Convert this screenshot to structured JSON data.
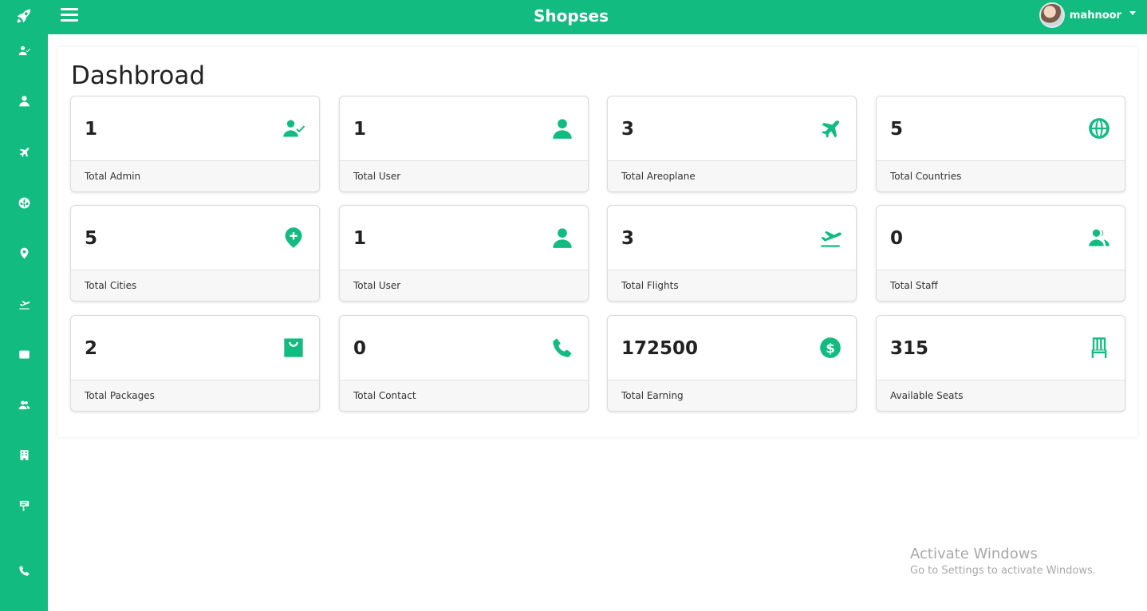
{
  "app": {
    "brand": "Shopses",
    "user_name": "mahnoor"
  },
  "colors": {
    "accent": "#12bb80",
    "text": "#222222",
    "footer": "#f7f7f7"
  },
  "page": {
    "title": "Dashbroad"
  },
  "sidebar": {
    "items": [
      {
        "icon": "rocket-icon"
      },
      {
        "icon": "user-check-icon"
      },
      {
        "icon": "user-icon"
      },
      {
        "icon": "plane-icon"
      },
      {
        "icon": "globe-icon"
      },
      {
        "icon": "map-pin-icon"
      },
      {
        "icon": "plane-departure-icon"
      },
      {
        "icon": "envelope-icon"
      },
      {
        "icon": "users-icon"
      },
      {
        "icon": "building-icon"
      },
      {
        "icon": "sign-icon"
      },
      {
        "icon": "phone-icon"
      }
    ]
  },
  "cards": [
    {
      "value": "1",
      "label": "Total Admin",
      "icon": "user-check-icon"
    },
    {
      "value": "1",
      "label": "Total User",
      "icon": "user-icon"
    },
    {
      "value": "3",
      "label": "Total Areoplane",
      "icon": "plane-icon"
    },
    {
      "value": "5",
      "label": "Total Countries",
      "icon": "globe-icon"
    },
    {
      "value": "5",
      "label": "Total Cities",
      "icon": "map-pin-plus-icon"
    },
    {
      "value": "1",
      "label": "Total User",
      "icon": "user-icon"
    },
    {
      "value": "3",
      "label": "Total Flights",
      "icon": "plane-departure-icon"
    },
    {
      "value": "0",
      "label": "Total Staff",
      "icon": "users-icon"
    },
    {
      "value": "2",
      "label": "Total Packages",
      "icon": "shopping-bag-icon"
    },
    {
      "value": "0",
      "label": "Total Contact",
      "icon": "phone-icon"
    },
    {
      "value": "172500",
      "label": "Total Earning",
      "icon": "dollar-icon"
    },
    {
      "value": "315",
      "label": "Available Seats",
      "icon": "chair-icon"
    }
  ],
  "watermark": {
    "title": "Activate Windows",
    "subtitle": "Go to Settings to activate Windows."
  }
}
